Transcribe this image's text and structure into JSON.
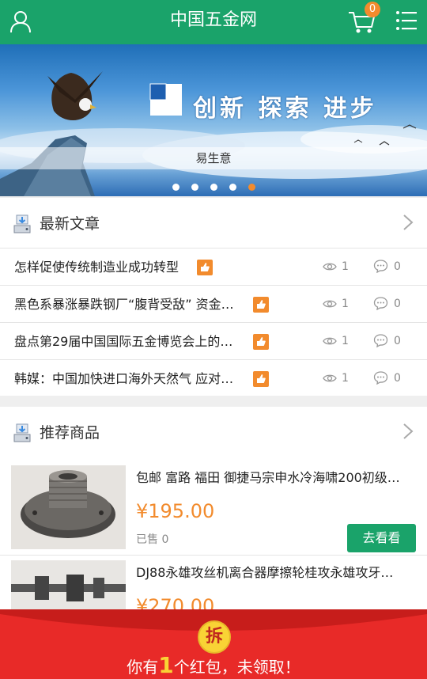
{
  "header": {
    "title": "中国五金网",
    "cart_count": "0",
    "icons": {
      "user": "user-icon",
      "cart": "cart-icon",
      "menu": "menu-list-icon"
    },
    "colors": {
      "primary": "#1aa36a",
      "accent": "#f28b2d"
    }
  },
  "banner": {
    "slogan": "创新 探索 进步",
    "caption": "易生意",
    "dot_count": 5,
    "active_dot": 5
  },
  "articles": {
    "title": "最新文章",
    "items": [
      {
        "title": "怎样促使传统制造业成功转型",
        "views": "1",
        "comments": "0"
      },
      {
        "title": "黑色系暴涨暴跌钢厂“腹背受敌” 资金…",
        "views": "1",
        "comments": "0"
      },
      {
        "title": "盘点第29届中国国际五金博览会上的…",
        "views": "1",
        "comments": "0"
      },
      {
        "title": "韩媒：中国加快进口海外天然气 应对…",
        "views": "1",
        "comments": "0"
      }
    ]
  },
  "products": {
    "title": "推荐商品",
    "items": [
      {
        "name": "包邮 富路 福田 御捷马宗申水冷海啸200初级…",
        "price": "¥195.00",
        "sold": "已售 0",
        "button": "去看看"
      },
      {
        "name": "DJ88永雄攻丝机离合器摩擦轮桂攻永雄攻牙…",
        "price": "¥270.00",
        "sold": "",
        "button": ""
      }
    ]
  },
  "red_packet": {
    "chai": "拆",
    "prefix": "你有",
    "count": "1",
    "suffix": "个红包，未领取！",
    "color": "#e82a28"
  }
}
